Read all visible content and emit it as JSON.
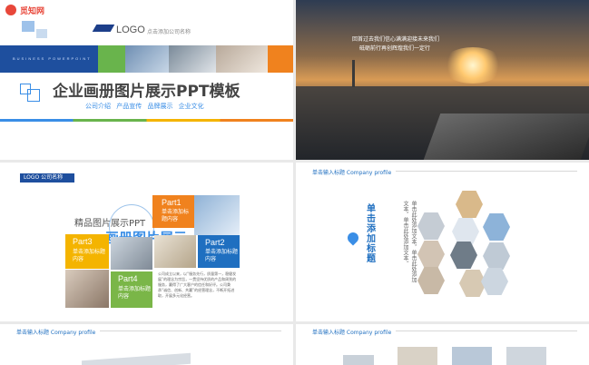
{
  "watermark": {
    "text": "觅知网"
  },
  "slide1": {
    "logo": "LOGO",
    "logo_sub": "点击添加公司名称",
    "band_text": "BUSINESS POWERPOINT",
    "title": "企业画册图片展示PPT模板",
    "subtitle": "公司介绍  产品宣传  品牌展示  企业文化"
  },
  "slide2": {
    "overlay_line1": "回首过去我们信心满满迎接未来我们",
    "overlay_line2": "砥砺前行再创辉煌我们一定行"
  },
  "slide3": {
    "logo": "LOGO 公司名称",
    "title_small": "精品图片展示PPT",
    "title_big": "画册图片展示",
    "parts": [
      {
        "label": "Part1",
        "text": "单击添加标题内容"
      },
      {
        "label": "Part2",
        "text": "单击添加标题内容"
      },
      {
        "label": "Part3",
        "text": "单击添加标题内容"
      },
      {
        "label": "Part4",
        "text": "单击添加标题内容"
      }
    ],
    "body": "公司成立以来，以“服务先行，质量第一，稳健发展”的理念为宗旨，一贯坚持优质的产品和周到的服务，赢得了广大客户的信任和好评。公司秉承“诚信、创新、共赢”的经营理念，不断开拓进取，开展多元化经营。"
  },
  "slide4": {
    "header": "单击输入标题 Company profile",
    "vtitle": "单击添加标题",
    "vtext": "单击此处添加文本，单击此处添加文本，单击此处添加文本。"
  },
  "slide5": {
    "header": "单击输入标题 Company profile"
  },
  "slide6": {
    "header": "单击输入标题 Company profile"
  },
  "colors": {
    "blue": "#1f6fc0",
    "orange": "#f0821e",
    "green": "#7ab648",
    "yellow": "#f4b400",
    "sky": "#3a8ee6"
  }
}
